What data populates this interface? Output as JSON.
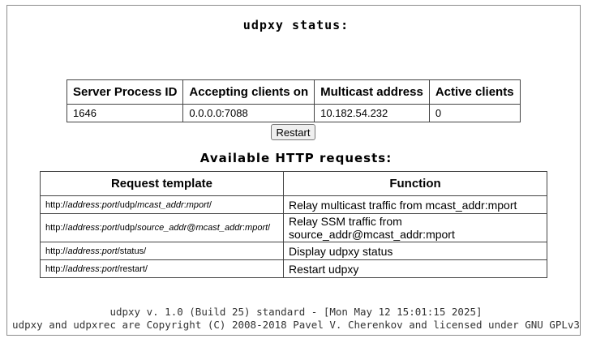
{
  "title": "udpxy status:",
  "status_table": {
    "headers": [
      "Server Process ID",
      "Accepting clients on",
      "Multicast address",
      "Active clients"
    ],
    "row": [
      "1646",
      "0.0.0.0:7088",
      "10.182.54.232",
      "0"
    ]
  },
  "restart_button": "Restart",
  "requests_heading": "Available HTTP requests:",
  "requests_table": {
    "headers": [
      "Request template",
      "Function"
    ],
    "rows": [
      {
        "template": {
          "prefix": "http://",
          "address": "address",
          "colon": ":",
          "port": "port",
          "path": "/udp/",
          "arg1": "mcast_addr",
          "sep": ":",
          "arg2": "mport",
          "suffix": "/"
        },
        "function": "Relay multicast traffic from mcast_addr:mport"
      },
      {
        "template": {
          "prefix": "http://",
          "address": "address",
          "colon": ":",
          "port": "port",
          "path": "/udp/",
          "arg1": "source_addr",
          "sep": "@",
          "arg2": "mcast_addr",
          "sep2": ":",
          "arg3": "mport",
          "suffix": "/"
        },
        "function": "Relay SSM traffic from source_addr@mcast_addr:mport"
      },
      {
        "template": {
          "prefix": "http://",
          "address": "address",
          "colon": ":",
          "port": "port",
          "path": "/status/"
        },
        "function": "Display udpxy status"
      },
      {
        "template": {
          "prefix": "http://",
          "address": "address",
          "colon": ":",
          "port": "port",
          "path": "/restart/"
        },
        "function": "Restart udpxy"
      }
    ]
  },
  "footer": {
    "version": "udpxy v. 1.0 (Build 25) standard - [Mon May 12 15:01:15 2025]",
    "copyright": "udpxy and udpxrec are Copyright (C) 2008-2018 Pavel V. Cherenkov and licensed under GNU GPLv3"
  }
}
